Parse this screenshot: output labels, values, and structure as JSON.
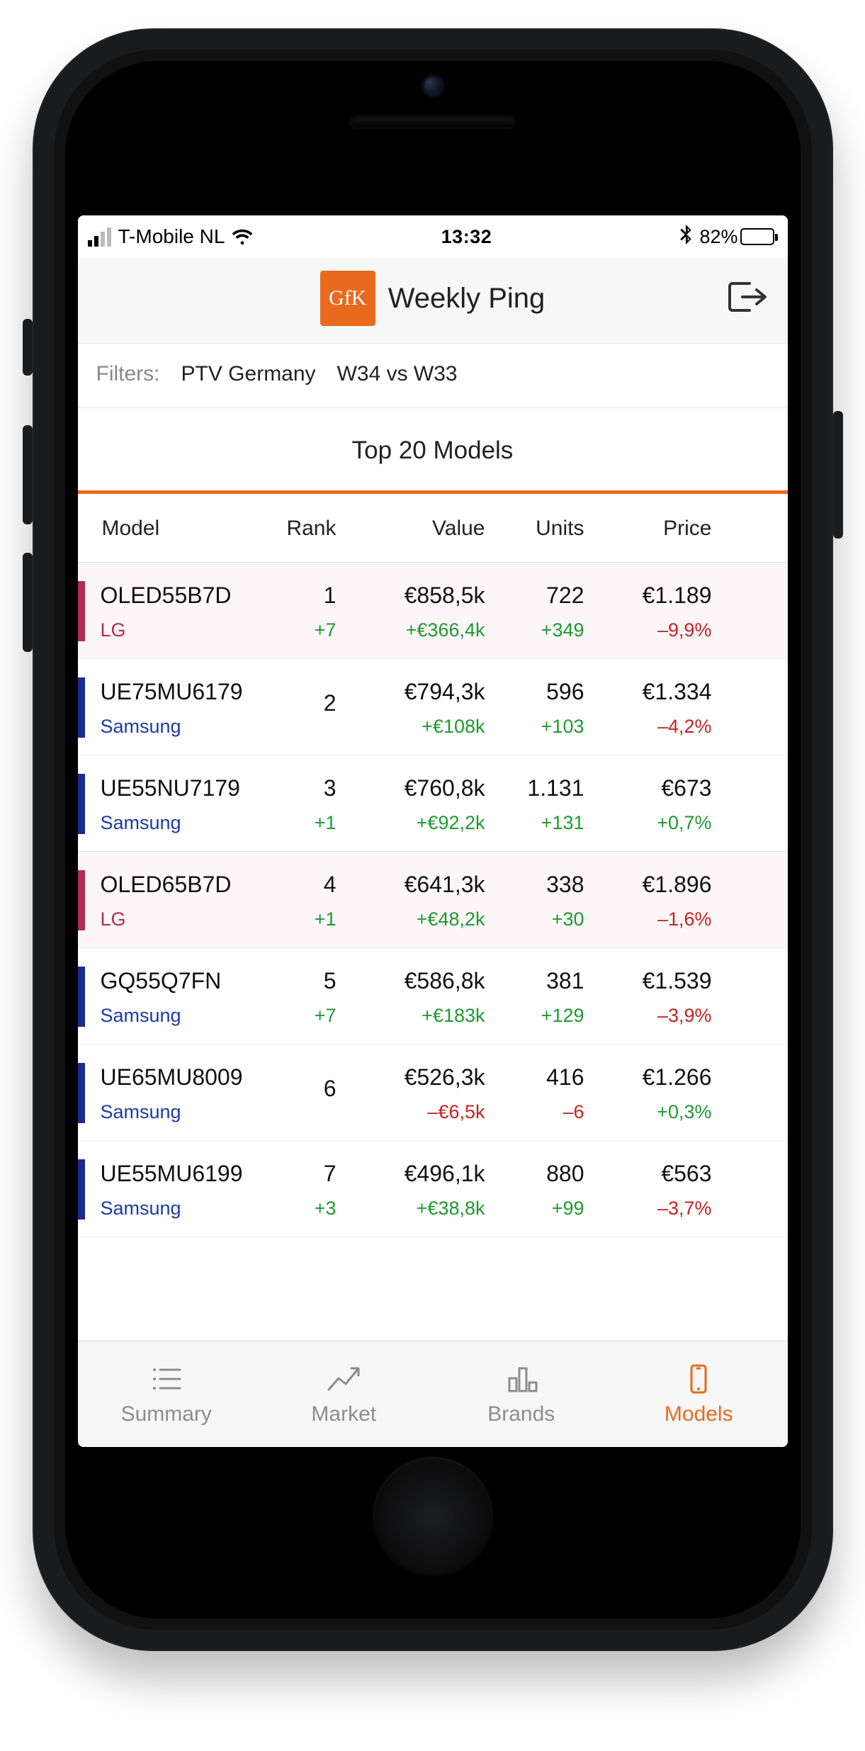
{
  "status_bar": {
    "carrier": "T-Mobile NL",
    "time": "13:32",
    "battery_pct": "82%"
  },
  "header": {
    "logo_text": "GfK",
    "title": "Weekly Ping"
  },
  "filters": {
    "label": "Filters:",
    "product": "PTV Germany",
    "period": "W34 vs W33"
  },
  "section_title": "Top 20 Models",
  "columns": {
    "model": "Model",
    "rank": "Rank",
    "value": "Value",
    "units": "Units",
    "price": "Price"
  },
  "rows": [
    {
      "brand": "LG",
      "brand_class": "lg",
      "model": "OLED55B7D",
      "rank": "1",
      "rank_delta": "+7",
      "rank_delta_sign": "pos",
      "value": "€858,5k",
      "value_delta": "+€366,4k",
      "value_delta_sign": "pos",
      "units": "722",
      "units_delta": "+349",
      "units_delta_sign": "pos",
      "price": "€1.189",
      "price_delta": "–9,9%",
      "price_delta_sign": "neg"
    },
    {
      "brand": "Samsung",
      "brand_class": "samsung",
      "model": "UE75MU6179",
      "rank": "2",
      "rank_delta": "",
      "rank_delta_sign": "neu",
      "value": "€794,3k",
      "value_delta": "+€108k",
      "value_delta_sign": "pos",
      "units": "596",
      "units_delta": "+103",
      "units_delta_sign": "pos",
      "price": "€1.334",
      "price_delta": "–4,2%",
      "price_delta_sign": "neg"
    },
    {
      "brand": "Samsung",
      "brand_class": "samsung",
      "model": "UE55NU7179",
      "rank": "3",
      "rank_delta": "+1",
      "rank_delta_sign": "pos",
      "value": "€760,8k",
      "value_delta": "+€92,2k",
      "value_delta_sign": "pos",
      "units": "1.131",
      "units_delta": "+131",
      "units_delta_sign": "pos",
      "price": "€673",
      "price_delta": "+0,7%",
      "price_delta_sign": "pos"
    },
    {
      "brand": "LG",
      "brand_class": "lg",
      "model": "OLED65B7D",
      "rank": "4",
      "rank_delta": "+1",
      "rank_delta_sign": "pos",
      "value": "€641,3k",
      "value_delta": "+€48,2k",
      "value_delta_sign": "pos",
      "units": "338",
      "units_delta": "+30",
      "units_delta_sign": "pos",
      "price": "€1.896",
      "price_delta": "–1,6%",
      "price_delta_sign": "neg"
    },
    {
      "brand": "Samsung",
      "brand_class": "samsung",
      "model": "GQ55Q7FN",
      "rank": "5",
      "rank_delta": "+7",
      "rank_delta_sign": "pos",
      "value": "€586,8k",
      "value_delta": "+€183k",
      "value_delta_sign": "pos",
      "units": "381",
      "units_delta": "+129",
      "units_delta_sign": "pos",
      "price": "€1.539",
      "price_delta": "–3,9%",
      "price_delta_sign": "neg"
    },
    {
      "brand": "Samsung",
      "brand_class": "samsung",
      "model": "UE65MU8009",
      "rank": "6",
      "rank_delta": "",
      "rank_delta_sign": "neu",
      "value": "€526,3k",
      "value_delta": "–€6,5k",
      "value_delta_sign": "neg",
      "units": "416",
      "units_delta": "–6",
      "units_delta_sign": "neg",
      "price": "€1.266",
      "price_delta": "+0,3%",
      "price_delta_sign": "pos"
    },
    {
      "brand": "Samsung",
      "brand_class": "samsung",
      "model": "UE55MU6199",
      "rank": "7",
      "rank_delta": "+3",
      "rank_delta_sign": "pos",
      "value": "€496,1k",
      "value_delta": "+€38,8k",
      "value_delta_sign": "pos",
      "units": "880",
      "units_delta": "+99",
      "units_delta_sign": "pos",
      "price": "€563",
      "price_delta": "–3,7%",
      "price_delta_sign": "neg"
    }
  ],
  "tabs": [
    {
      "label": "Summary",
      "active": false
    },
    {
      "label": "Market",
      "active": false
    },
    {
      "label": "Brands",
      "active": false
    },
    {
      "label": "Models",
      "active": true
    }
  ]
}
